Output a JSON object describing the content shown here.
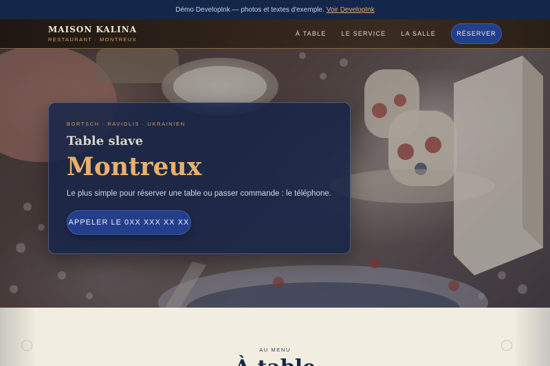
{
  "demo_bar": {
    "text": "Démo DevelopInk — photos et textes d'exemple.",
    "link": "Voir DevelopInk"
  },
  "header": {
    "brand_name": "MAISON KALINA",
    "brand_sub": "RESTAURANT · MONTREUX",
    "nav": [
      {
        "label": "À TABLE"
      },
      {
        "label": "LE SERVICE"
      },
      {
        "label": "LA SALLE"
      }
    ],
    "cta": "RÉSERVER"
  },
  "hero": {
    "kicker": "BORTSCH · RAVIOLIS · UKRAINIEN",
    "tagline": "Table slave",
    "city": "Montreux",
    "description": "Le plus simple pour réserver une table ou passer commande : le téléphone.",
    "cta": "APPELER LE 0XX XXX XX XX"
  },
  "menu_section": {
    "kicker": "AU MENU",
    "title": "À table"
  },
  "colors": {
    "navy": "#14264a",
    "card": "#182648",
    "accent_gold": "#e8b06a",
    "button_blue": "#233f8c",
    "cream": "#f1ede0"
  }
}
